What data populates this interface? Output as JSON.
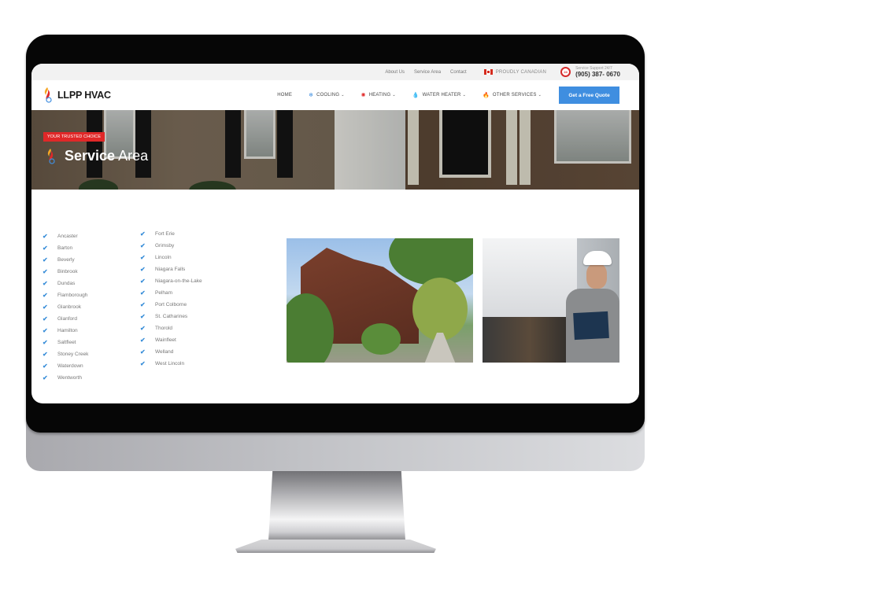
{
  "topbar": {
    "links": [
      "About Us",
      "Service Area",
      "Contact"
    ],
    "canada_label": "PROUDLY CANADIAN",
    "support_badge": "24",
    "support_label": "Service Support 24/7",
    "phone": "(905) 387- 0670"
  },
  "navbar": {
    "logo_text": "LLPP HVAC",
    "items": [
      {
        "label": "HOME",
        "icon": "",
        "dropdown": false
      },
      {
        "label": "COOLING",
        "icon": "snowflake-icon",
        "dropdown": true
      },
      {
        "label": "HEATING",
        "icon": "heat-icon",
        "dropdown": true
      },
      {
        "label": "WATER HEATER",
        "icon": "water-drop-icon",
        "dropdown": true
      },
      {
        "label": "OTHER SERVICES",
        "icon": "flame-drop-icon",
        "dropdown": true
      }
    ],
    "cta_label": "Get a Free Quote"
  },
  "hero": {
    "badge": "YOUR TRUSTED CHOICE",
    "title_bold": "Service",
    "title_light": "Area"
  },
  "service_areas": {
    "column1": [
      "Ancaster",
      "Barton",
      "Beverly",
      "Binbrook",
      "Dundas",
      "Flamborough",
      "Glanbrook",
      "Glanford",
      "Hamilton",
      "Saltfleet",
      "Stoney Creek",
      "Waterdown",
      "Wentworth"
    ],
    "column2": [
      "Fort Erie",
      "Grimsby",
      "Lincoln",
      "Niagara Falls",
      "Niagara-on-the-Lake",
      "Pelham",
      "Port Colborne",
      "St. Catharines",
      "Thorold",
      "Wainfleet",
      "Welland",
      "West Lincoln"
    ]
  },
  "images": {
    "house_alt": "Brick residential houses on tree-lined street",
    "tech_alt": "HVAC technician with clipboard next to boiler"
  },
  "colors": {
    "accent_blue": "#3f8ee0",
    "badge_red": "#e02828",
    "check_blue": "#3b8fd9"
  }
}
